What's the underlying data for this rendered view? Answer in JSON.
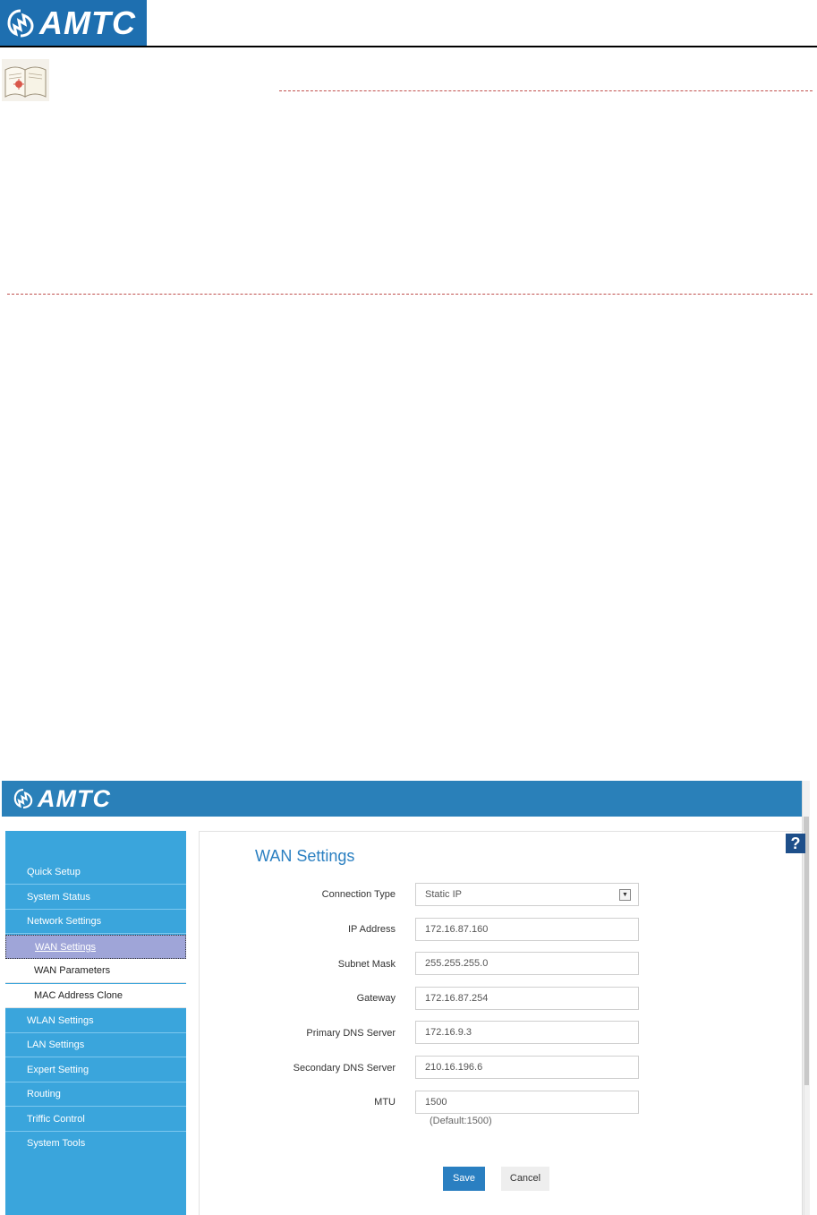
{
  "document": {
    "logo_text": "AMTC"
  },
  "router": {
    "logo_text": "AMTC",
    "sidebar": {
      "items": [
        {
          "label": "Quick Setup"
        },
        {
          "label": "System Status"
        },
        {
          "label": "Network Settings"
        },
        {
          "label": "WLAN Settings"
        },
        {
          "label": "LAN Settings"
        },
        {
          "label": "Expert Setting"
        },
        {
          "label": "Routing"
        },
        {
          "label": "Triffic Control"
        },
        {
          "label": "System Tools"
        }
      ],
      "subitems": [
        {
          "label": "WAN Settings",
          "active": true
        },
        {
          "label": "WAN Parameters"
        },
        {
          "label": "MAC Address Clone"
        }
      ]
    },
    "help_label": "?",
    "page_title": "WAN Settings",
    "form": {
      "connection_type": {
        "label": "Connection Type",
        "value": "Static IP"
      },
      "ip_address": {
        "label": "IP Address",
        "value": "172.16.87.160"
      },
      "subnet_mask": {
        "label": "Subnet Mask",
        "value": "255.255.255.0"
      },
      "gateway": {
        "label": "Gateway",
        "value": "172.16.87.254"
      },
      "primary_dns": {
        "label": "Primary DNS Server",
        "value": "172.16.9.3"
      },
      "secondary_dns": {
        "label": "Secondary DNS Server",
        "value": "210.16.196.6"
      },
      "mtu": {
        "label": "MTU",
        "value": "1500",
        "hint": "(Default:1500)"
      }
    },
    "buttons": {
      "save": "Save",
      "cancel": "Cancel"
    }
  },
  "colors": {
    "brand_blue": "#2a80b9",
    "sidebar_blue": "#3aa5dc",
    "active_item": "#9fa5d8",
    "title_blue": "#2a7fc1",
    "dash_red": "#c0504d"
  }
}
